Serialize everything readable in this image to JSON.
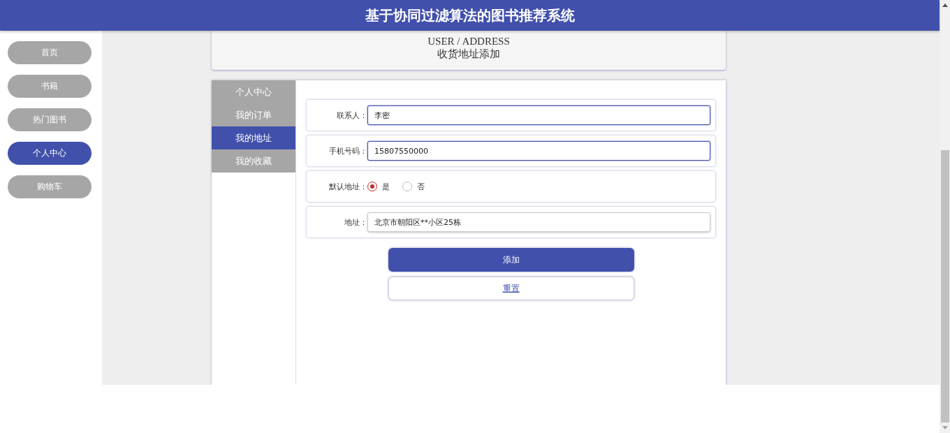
{
  "header": {
    "title": "基于协同过滤算法的图书推荐系统"
  },
  "sidebar": {
    "items": [
      {
        "label": "首页",
        "selected": false
      },
      {
        "label": "书籍",
        "selected": false
      },
      {
        "label": "热门图书",
        "selected": false
      },
      {
        "label": "个人中心",
        "selected": true
      },
      {
        "label": "购物车",
        "selected": false
      }
    ]
  },
  "page_heading": {
    "breadcrumb": "USER / ADDRESS",
    "title": "收货地址添加"
  },
  "tabs": [
    {
      "label": "个人中心",
      "selected": false
    },
    {
      "label": "我的订单",
      "selected": false
    },
    {
      "label": "我的地址",
      "selected": true
    },
    {
      "label": "我的收藏",
      "selected": false
    }
  ],
  "form": {
    "fields": [
      {
        "kind": "input",
        "label": "联系人：",
        "value": "李密",
        "focused": true
      },
      {
        "kind": "input",
        "label": "手机号码：",
        "value": "15807550000",
        "focused": true
      },
      {
        "kind": "radio",
        "label": "默认地址：",
        "options": [
          {
            "label": "是",
            "selected": true
          },
          {
            "label": "否",
            "selected": false
          }
        ]
      },
      {
        "kind": "input",
        "label": "地址：",
        "value": "北京市朝阳区**小区25栋",
        "focused": false
      }
    ],
    "buttons": [
      {
        "kind": "primary",
        "label": "添加"
      },
      {
        "kind": "secondary",
        "label": "重置"
      }
    ]
  }
}
